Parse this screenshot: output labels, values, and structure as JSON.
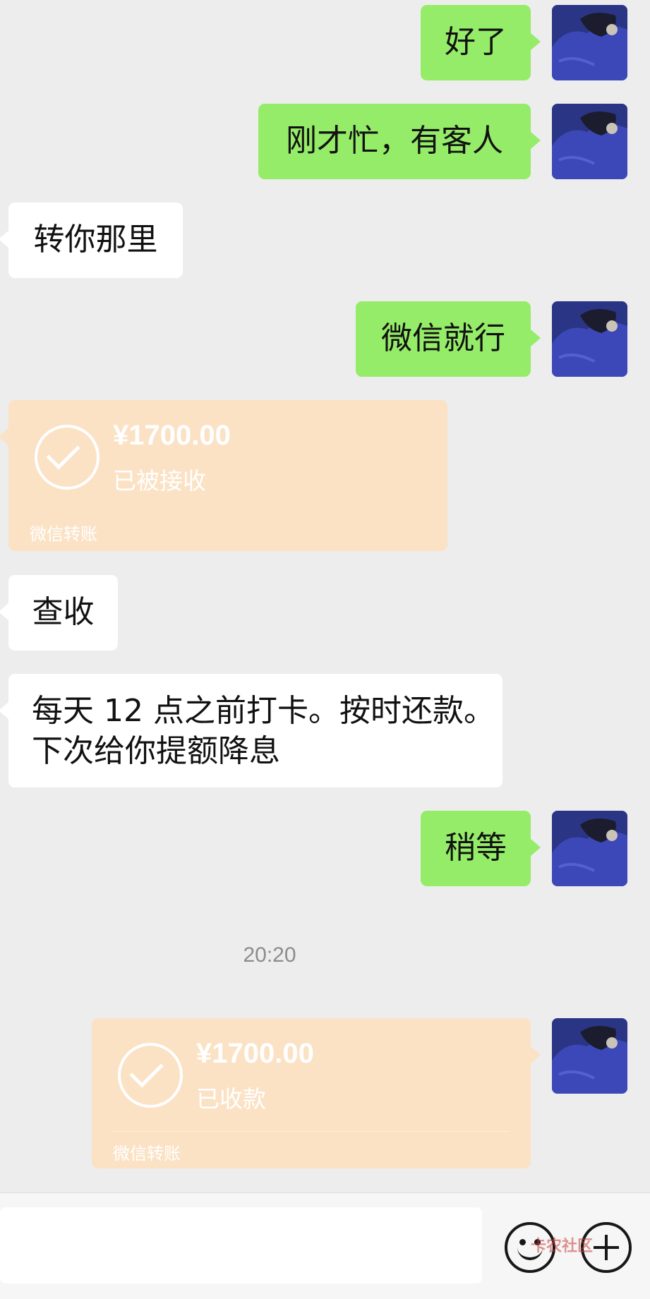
{
  "messages": [
    {
      "side": "right",
      "type": "text",
      "text": "好了"
    },
    {
      "side": "right",
      "type": "text",
      "text": "刚才忙，有客人"
    },
    {
      "side": "left",
      "type": "text",
      "text": "转你那里"
    },
    {
      "side": "right",
      "type": "text",
      "text": "微信就行"
    },
    {
      "side": "left",
      "type": "transfer",
      "amount": "¥1700.00",
      "status": "已被接收",
      "label": "微信转账"
    },
    {
      "side": "left",
      "type": "text",
      "text": "查收"
    },
    {
      "side": "left",
      "type": "text",
      "lines": [
        "每天 12 点之前打卡。按时还款。",
        "下次给你提额降息"
      ]
    },
    {
      "side": "right",
      "type": "text",
      "text": "稍等"
    },
    {
      "side": "right",
      "type": "transfer",
      "amount": "¥1700.00",
      "status": "已收款",
      "label": "微信转账"
    }
  ],
  "timestamp": "20:20",
  "input": {
    "placeholder": "",
    "emoji_icon": "emoji-icon",
    "plus_icon": "plus-icon"
  },
  "watermark": "卡农社区",
  "colors": {
    "background": "#ededed",
    "self_bubble": "#95ec69",
    "other_bubble": "#ffffff",
    "transfer_card": "#fbe2c5"
  }
}
